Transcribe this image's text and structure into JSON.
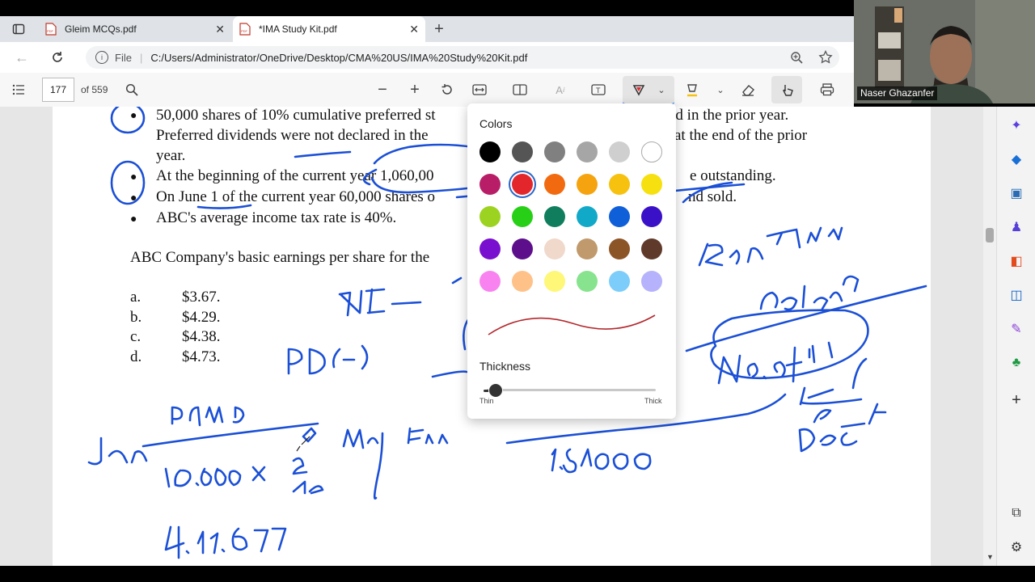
{
  "tabs": [
    {
      "title": "Gleim MCQs.pdf",
      "active": false
    },
    {
      "title": "*IMA Study Kit.pdf",
      "active": true
    }
  ],
  "address": {
    "scheme_label": "File",
    "url": "C:/Users/Administrator/OneDrive/Desktop/CMA%20US/IMA%20Study%20Kit.pdf"
  },
  "pdf_toolbar": {
    "page_current": "177",
    "page_total": "of 559"
  },
  "webcam": {
    "name": "Naser Ghazanfer"
  },
  "document": {
    "lines": [
      "50,000 shares of 10% cumulative preferred st",
      "ed in the prior year.",
      "Preferred dividends were not declared in the",
      "at the end of the prior",
      "year.",
      "At the beginning of the current year 1,060,00",
      "e outstanding.",
      "On June 1 of the current year 60,000 shares o",
      "nd sold.",
      "ABC's average income tax rate is 40%.",
      "ABC Company's basic earnings per share for the"
    ],
    "options": [
      {
        "letter": "a.",
        "value": "$3.67."
      },
      {
        "letter": "b.",
        "value": "$4.29."
      },
      {
        "letter": "c.",
        "value": "$4.38."
      },
      {
        "letter": "d.",
        "value": "$4.73."
      }
    ]
  },
  "ink_colors": {
    "blue": "#1a4fd6"
  },
  "popup": {
    "colors_label": "Colors",
    "thickness_label": "Thickness",
    "thin_label": "Thin",
    "thick_label": "Thick",
    "selected_color": "#e3262c",
    "thickness_value": 0.05,
    "swatches": [
      "#000000",
      "#555555",
      "#808080",
      "#a6a6a6",
      "#cfcfcf",
      "#ffffff",
      "#b81e67",
      "#e3262c",
      "#f26a10",
      "#f5a40f",
      "#f6c20f",
      "#f7e00f",
      "#9cd320",
      "#27d017",
      "#107e5d",
      "#11a9c8",
      "#0f5fd9",
      "#3a11c7",
      "#7a10cf",
      "#5d0f8b",
      "#f0d8cb",
      "#c09a6c",
      "#8c5528",
      "#5f3a2a",
      "#f883f0",
      "#fec289",
      "#fef777",
      "#87e38d",
      "#7ccdfa",
      "#b6b2fb"
    ]
  }
}
